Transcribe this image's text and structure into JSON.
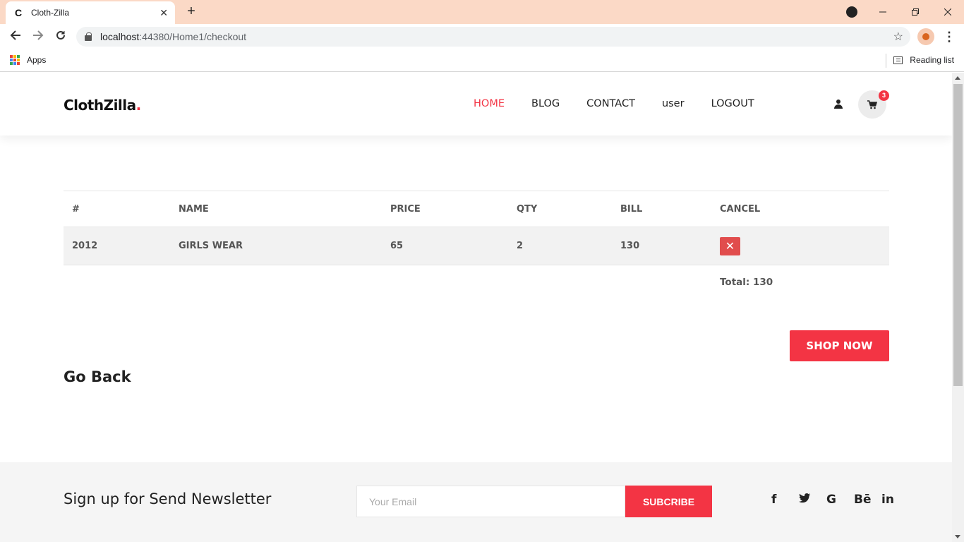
{
  "browser": {
    "tab_title": "Cloth-Zilla",
    "tab_favicon": "C",
    "tab_close": "✕",
    "new_tab": "+",
    "url_host": "localhost",
    "url_rest": ":44380/Home1/checkout",
    "bookmarks": {
      "apps_label": "Apps",
      "reading_list_label": "Reading list"
    }
  },
  "header": {
    "logo_text": "ClothZilla",
    "logo_dot": ".",
    "accent_color": "#f33444",
    "nav": [
      {
        "label": "HOME",
        "active": true
      },
      {
        "label": "BLOG"
      },
      {
        "label": "CONTACT"
      },
      {
        "label": "user"
      },
      {
        "label": "LOGOUT"
      }
    ],
    "cart_count": "3"
  },
  "cart": {
    "columns": [
      "#",
      "NAME",
      "PRICE",
      "QTY",
      "BILL",
      "CANCEL"
    ],
    "rows": [
      {
        "id": "2012",
        "name": "GIRLS WEAR",
        "price": "65",
        "qty": "2",
        "bill": "130"
      }
    ],
    "cancel_glyph": "✕",
    "total_label": "Total: 130"
  },
  "actions": {
    "shop_now": "SHOP NOW",
    "go_back": "Go Back"
  },
  "footer": {
    "newsletter_title": "Sign up for Send Newsletter",
    "email_placeholder": "Your Email",
    "subscribe_label": "SUBCRIBE",
    "social": [
      "f",
      "t",
      "G",
      "Bē",
      "in"
    ]
  }
}
